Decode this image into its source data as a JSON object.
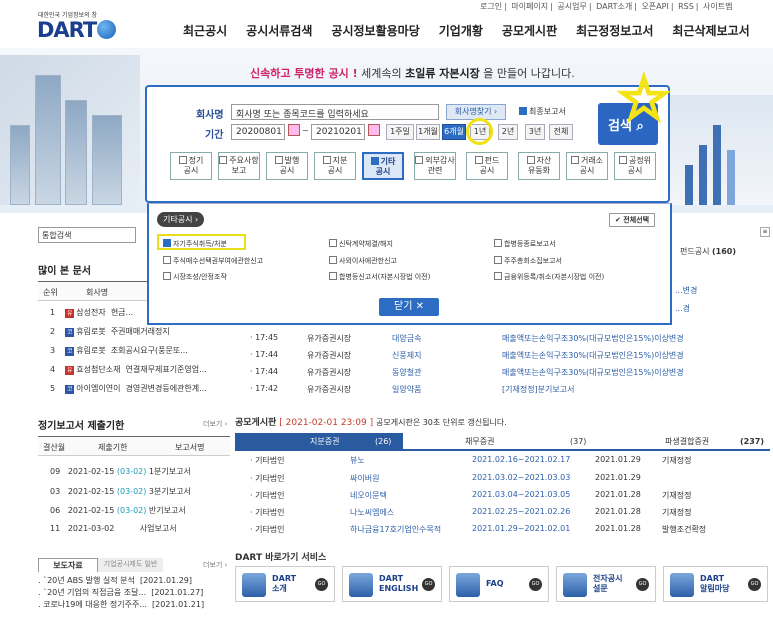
{
  "util": [
    "로그인",
    "마이페이지",
    "공시업무",
    "DART소개",
    "오픈API",
    "RSS",
    "사이트맵"
  ],
  "logo": {
    "sub": "대한민국 기업정보의 창",
    "text": "DART"
  },
  "gnb": [
    "최근공시",
    "공시서류검색",
    "공시정보활용마당",
    "기업개황",
    "공모게시판",
    "최근정정보고서",
    "최근삭제보고서"
  ],
  "slogan": {
    "a": "신속하고 투명한 공시 !",
    "b": "세계속의 ",
    "c": "초일류",
    "d": " 자본시장",
    "e": "을 만들어 나갑니다."
  },
  "search": {
    "company_label": "회사명",
    "company_placeholder": "회사명 또는 종목코드를 입력하세요",
    "company_search_btn": "회사명찾기 ›",
    "final_report": "최종보고서",
    "period_label": "기간",
    "date_from": "20200801",
    "date_to": "20210201",
    "tilde": "~",
    "periods": [
      "1주일",
      "1개월",
      "6개월",
      "1년",
      "2년",
      "3년",
      "전체"
    ],
    "search_btn": "검색",
    "categories": [
      "정기\n공시",
      "주요사항\n보고",
      "발행\n공시",
      "지분\n공시",
      "기타\n공시",
      "외부감사\n관련",
      "펀드\n공시",
      "자산\n유동화",
      "거래소\n공시",
      "공정위\n공시"
    ]
  },
  "popup": {
    "title": "기타공시 ›",
    "select_all": "✔ 전체선택",
    "items": [
      [
        "자기주식취득/처분",
        "신탁계약체결/해지",
        "합병등종료보고서"
      ],
      [
        "주식매수선택권부여에관한신고",
        "사외이사에관한신고",
        "주주총회소집보고서"
      ],
      [
        "시장조성/안정조작",
        "합병등신고서(자본시장법 이전)",
        "금융위등록/취소(자본시장법 이전)"
      ]
    ],
    "close": "닫기 ✕"
  },
  "left": {
    "total_search": "통합검색",
    "popular_title": "많이 본 문서",
    "popular_headers": [
      "순위",
      "회사명"
    ],
    "popular": [
      {
        "rank": "1",
        "badge": "유",
        "company": "삼성전자",
        "doc": "현금..."
      },
      {
        "rank": "2",
        "badge": "코",
        "company": "휴림로봇",
        "doc": "주권매매거래정지"
      },
      {
        "rank": "3",
        "badge": "코",
        "company": "휴림로봇",
        "doc": "조회공시요구(풍문또..."
      },
      {
        "rank": "4",
        "badge": "유",
        "company": "효성첨단소재",
        "doc": "연결재무제표기준영업..."
      },
      {
        "rank": "5",
        "badge": "코",
        "company": "아이엠이연이",
        "doc": "경영권변경등에관한계..."
      }
    ],
    "periodic_title": "정기보고서 제출기한",
    "more": "더보기 ›",
    "periodic_headers": [
      "결산월",
      "제출기한",
      "보고서명"
    ],
    "periodic": [
      {
        "m": "09",
        "d": "2021-02-15",
        "e": "(03-02)",
        "r": "1분기보고서"
      },
      {
        "m": "03",
        "d": "2021-02-15",
        "e": "(03-02)",
        "r": "3분기보고서"
      },
      {
        "m": "06",
        "d": "2021-02-15",
        "e": "(03-02)",
        "r": "반기보고서"
      },
      {
        "m": "11",
        "d": "2021-03-02",
        "e": "",
        "r": "사업보고서"
      }
    ],
    "press_tabs": [
      "보도자료",
      "기업공시제도 일반"
    ],
    "press": [
      {
        "t": "`20년 ABS 발행 실적 분석",
        "d": "[2021.01.29]"
      },
      {
        "t": "`20년 기업의 직접금융 조달...",
        "d": "[2021.01.27]"
      },
      {
        "t": "코로나19에 대응한 정기주주...",
        "d": "[2021.01.21]"
      }
    ]
  },
  "main": {
    "fund_tab": "펀드공시",
    "fund_count": "(160)",
    "recent_rows": [
      {
        "time": "· 17:45",
        "market": "유가증권시장",
        "company": "대양금속",
        "report": "매출액또는손익구조30%(대규모법인은15%)이상변경"
      },
      {
        "time": "· 17:44",
        "market": "유가증권시장",
        "company": "신풍제지",
        "report": "매출액또는손익구조30%(대규모법인은15%)이상변경"
      },
      {
        "time": "· 17:44",
        "market": "유가증권시장",
        "company": "동양철관",
        "report": "매출액또는손익구조30%(대규모법인은15%)이상변경"
      },
      {
        "time": "· 17:42",
        "market": "유가증권시장",
        "company": "일양약품",
        "report": "[기재정정]분기보고서"
      }
    ],
    "partial_row": "...변경",
    "partial_row2": "...경",
    "board_title": "공모게시판",
    "board_time": "[ 2021-02-01 23:09 ]",
    "board_note": "공모게시판은 30초 단위로 갱신됩니다.",
    "board_tabs": [
      {
        "n": "지분증권",
        "c": "(26)"
      },
      {
        "n": "채무증권",
        "c": "(37)"
      },
      {
        "n": "파생결합증권",
        "c": "(237)"
      }
    ],
    "board_rows": [
      {
        "a": "· 기타법인",
        "b": "뷰노",
        "c": "2021.02.16~2021.02.17",
        "d": "2021.01.29",
        "e": "기재정정"
      },
      {
        "a": "· 기타법인",
        "b": "싸이버원",
        "c": "2021.03.02~2021.03.03",
        "d": "2021.01.29",
        "e": ""
      },
      {
        "a": "· 기타법인",
        "b": "네오이뮨텍",
        "c": "2021.03.04~2021.03.05",
        "d": "2021.01.28",
        "e": "기재정정"
      },
      {
        "a": "· 기타법인",
        "b": "나노씨엠에스",
        "c": "2021.02.25~2021.02.26",
        "d": "2021.01.28",
        "e": "기재정정"
      },
      {
        "a": "· 기타법인",
        "b": "하나금융17호기업인수목적",
        "c": "2021.01.29~2021.02.01",
        "d": "2021.01.28",
        "e": "발행조건확정"
      }
    ],
    "services_title": "DART 바로가기 서비스",
    "services": [
      "DART\n소개",
      "DART\nENGLISH",
      "FAQ",
      "전자공시\n설문",
      "DART\n알림마당"
    ],
    "go": "GO"
  }
}
